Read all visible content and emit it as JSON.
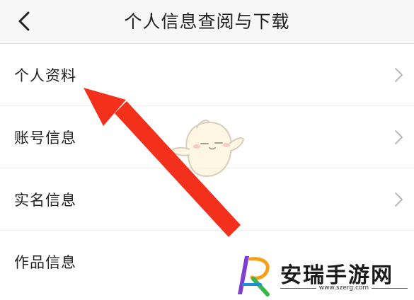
{
  "header": {
    "title": "个人信息查阅与下载",
    "back_icon": "chevron-left-icon"
  },
  "menu": {
    "items": [
      {
        "label": "个人资料",
        "has_chevron": true
      },
      {
        "label": "账号信息",
        "has_chevron": true
      },
      {
        "label": "实名信息",
        "has_chevron": true
      },
      {
        "label": "作品信息",
        "has_chevron": false
      }
    ]
  },
  "overlay": {
    "arrow_color": "#f2301b",
    "watermark": {
      "name": "安瑞手游网",
      "url": "www.szerg.com"
    }
  }
}
